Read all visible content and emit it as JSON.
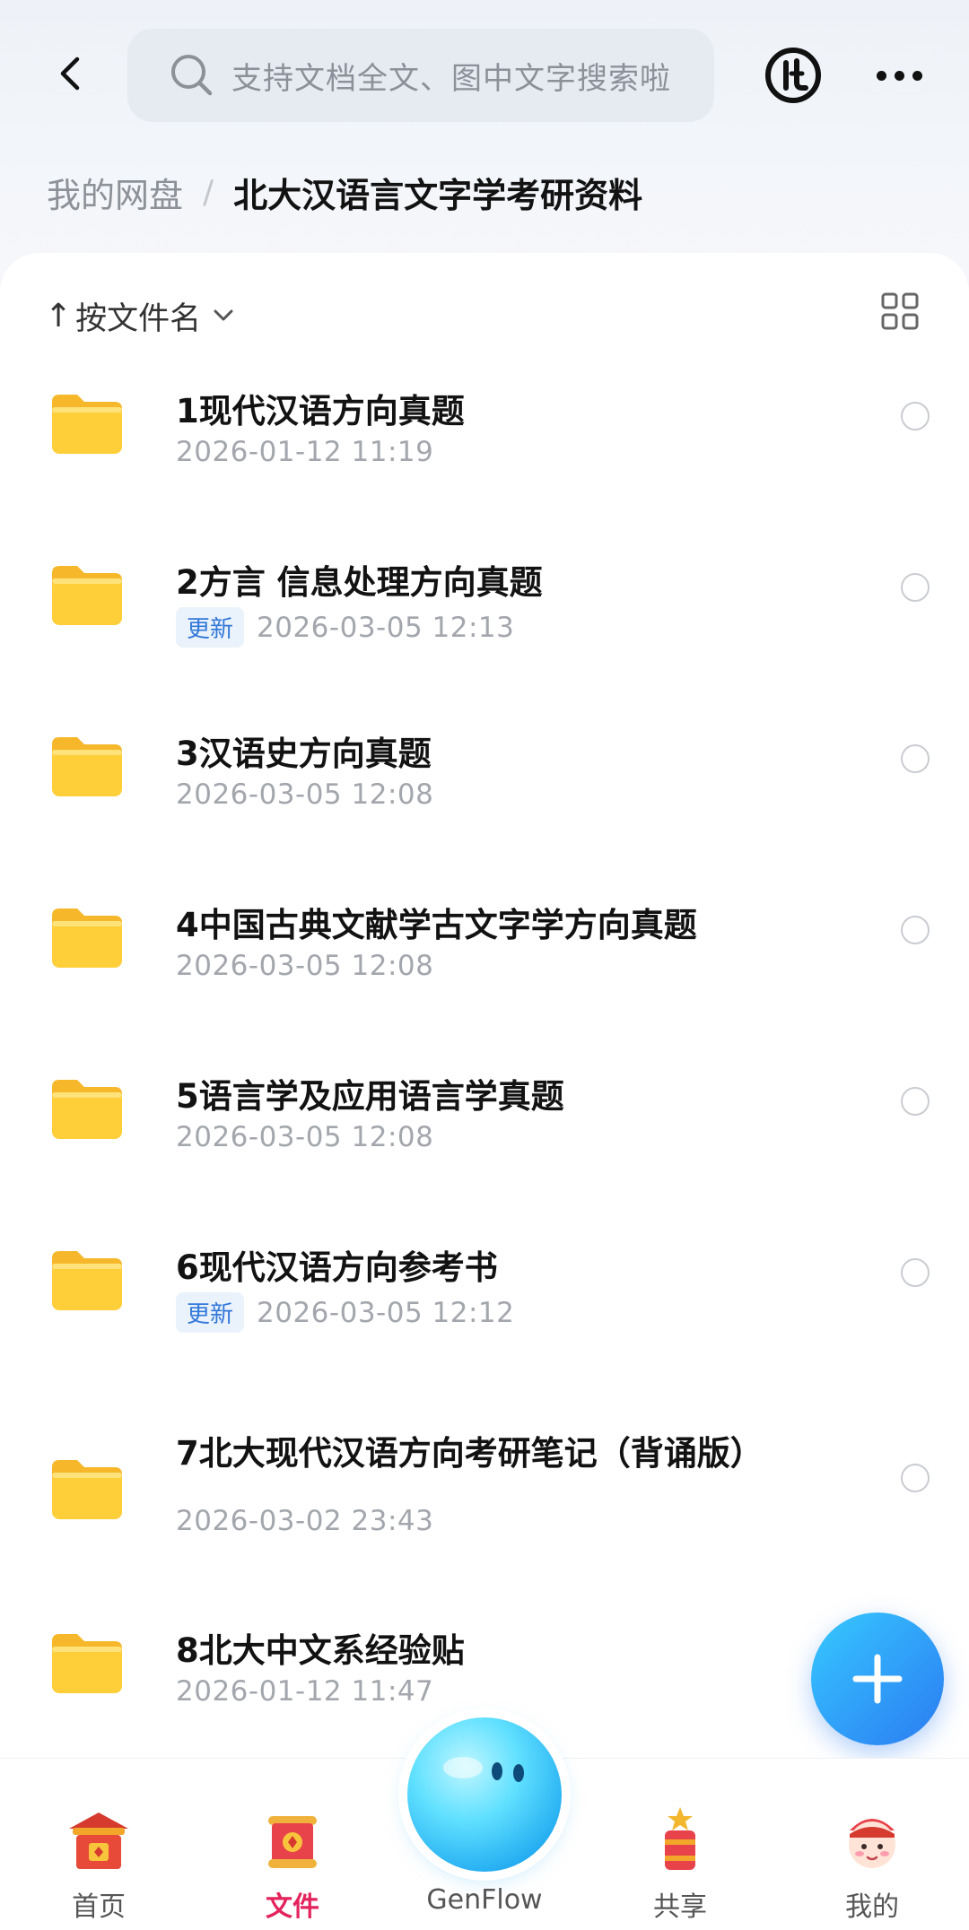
{
  "header": {
    "search_placeholder": "支持文档全文、图中文字搜索啦",
    "icons": {
      "back": "back-arrow-icon",
      "search": "search-icon",
      "logo": "app-logo-icon",
      "more": "more-dots-icon"
    }
  },
  "breadcrumb": {
    "root": "我的网盘",
    "separator": "/",
    "current": "北大汉语言文字学考研资料"
  },
  "sort": {
    "arrow": "↑",
    "label": "按文件名",
    "icons": {
      "chevron": "chevron-down-icon",
      "view_toggle": "grid-view-icon"
    }
  },
  "files": [
    {
      "name": "1现代汉语方向真题",
      "time": "2026-01-12 11:19",
      "badge": ""
    },
    {
      "name": "2方言 信息处理方向真题",
      "time": "2026-03-05 12:13",
      "badge": "更新"
    },
    {
      "name": "3汉语史方向真题",
      "time": "2026-03-05 12:08",
      "badge": ""
    },
    {
      "name": "4中国古典文献学古文字学方向真题",
      "time": "2026-03-05 12:08",
      "badge": ""
    },
    {
      "name": "5语言学及应用语言学真题",
      "time": "2026-03-05 12:08",
      "badge": ""
    },
    {
      "name": "6现代汉语方向参考书",
      "time": "2026-03-05 12:12",
      "badge": "更新"
    },
    {
      "name": "7北大现代汉语方向考研笔记（背诵版）",
      "time": "2026-03-02 23:43",
      "badge": ""
    },
    {
      "name": "8北大中文系经验贴",
      "time": "2026-01-12 11:47",
      "badge": ""
    }
  ],
  "fab": {
    "icon": "plus-icon"
  },
  "nav": {
    "active": "files",
    "items": [
      {
        "id": "home",
        "label": "首页",
        "icon": "home-temple-icon"
      },
      {
        "id": "files",
        "label": "文件",
        "icon": "files-scroll-icon"
      },
      {
        "id": "genflow",
        "label": "GenFlow",
        "icon": "genflow-orb-icon"
      },
      {
        "id": "share",
        "label": "共享",
        "icon": "share-firecracker-icon"
      },
      {
        "id": "me",
        "label": "我的",
        "icon": "profile-avatar-icon"
      }
    ]
  },
  "colors": {
    "accent_active": "#e3245c",
    "badge_text": "#3278d8",
    "folder_yellow": "#ffcf3a",
    "fab_blue": "#2b7bf2"
  }
}
